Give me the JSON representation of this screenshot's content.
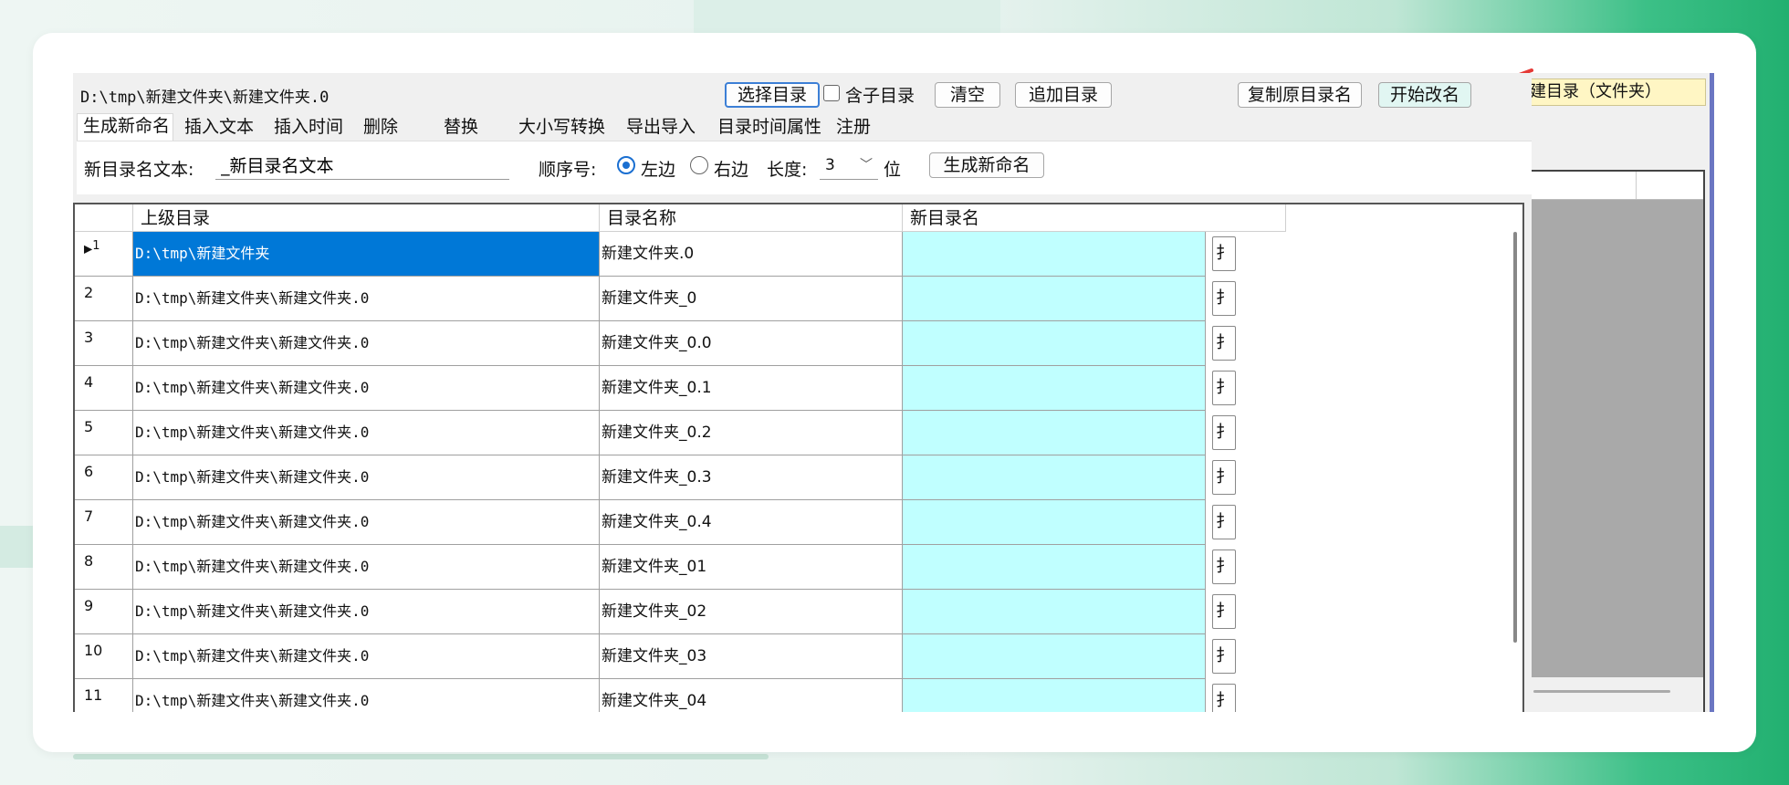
{
  "window": {
    "path": "D:\\tmp\\新建文件夹\\新建文件夹.0",
    "buttons": {
      "select_dir": "选择目录",
      "include_sub": "含子目录",
      "clear": "清空",
      "append_dir": "追加目录",
      "copy_name": "复制原目录名",
      "start_rename": "开始改名"
    },
    "tabs": [
      "生成新命名",
      "插入文本",
      "插入时间",
      "删除",
      "替换",
      "大小写转换",
      "导出导入",
      "目录时间属性",
      "注册"
    ],
    "active_tab": "生成新命名",
    "panel": {
      "new_name_label": "新目录名文本:",
      "new_name_value": "_新目录名文本",
      "seq_label": "顺序号:",
      "left_label": "左边",
      "right_label": "右边",
      "length_label": "长度:",
      "length_value": "3",
      "unit_label": "位",
      "generate_button": "生成新命名"
    },
    "grid": {
      "columns": [
        "上级目录",
        "目录名称",
        "新目录名"
      ],
      "row_button_glyph": "扌",
      "rows": [
        {
          "idx": "1",
          "parent": "D:\\tmp\\新建文件夹",
          "name": "新建文件夹.0",
          "new": ""
        },
        {
          "idx": "2",
          "parent": "D:\\tmp\\新建文件夹\\新建文件夹.0",
          "name": "新建文件夹_0",
          "new": ""
        },
        {
          "idx": "3",
          "parent": "D:\\tmp\\新建文件夹\\新建文件夹.0",
          "name": "新建文件夹_0.0",
          "new": ""
        },
        {
          "idx": "4",
          "parent": "D:\\tmp\\新建文件夹\\新建文件夹.0",
          "name": "新建文件夹_0.1",
          "new": ""
        },
        {
          "idx": "5",
          "parent": "D:\\tmp\\新建文件夹\\新建文件夹.0",
          "name": "新建文件夹_0.2",
          "new": ""
        },
        {
          "idx": "6",
          "parent": "D:\\tmp\\新建文件夹\\新建文件夹.0",
          "name": "新建文件夹_0.3",
          "new": ""
        },
        {
          "idx": "7",
          "parent": "D:\\tmp\\新建文件夹\\新建文件夹.0",
          "name": "新建文件夹_0.4",
          "new": ""
        },
        {
          "idx": "8",
          "parent": "D:\\tmp\\新建文件夹\\新建文件夹.0",
          "name": "新建文件夹_01",
          "new": ""
        },
        {
          "idx": "9",
          "parent": "D:\\tmp\\新建文件夹\\新建文件夹.0",
          "name": "新建文件夹_02",
          "new": ""
        },
        {
          "idx": "10",
          "parent": "D:\\tmp\\新建文件夹\\新建文件夹.0",
          "name": "新建文件夹_03",
          "new": ""
        },
        {
          "idx": "11",
          "parent": "D:\\tmp\\新建文件夹\\新建文件夹.0",
          "name": "新建文件夹_04",
          "new": ""
        }
      ]
    }
  },
  "behind_window": {
    "button": "创建目录（文件夹）"
  },
  "colors": {
    "selected_row": "#0078d7",
    "new_name_cell": "#c0ffff",
    "accent_radio": "#1a6fd1",
    "arrow": "#e53935"
  }
}
